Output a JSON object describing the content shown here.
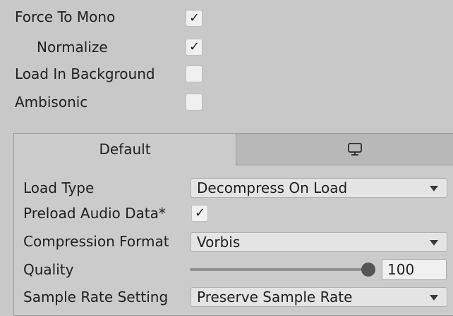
{
  "toggles": {
    "force_to_mono": {
      "label": "Force To Mono",
      "checked": true
    },
    "normalize": {
      "label": "Normalize",
      "checked": true
    },
    "load_in_background": {
      "label": "Load In Background",
      "checked": false
    },
    "ambisonic": {
      "label": "Ambisonic",
      "checked": false
    }
  },
  "platform_tabs": {
    "default_label": "Default",
    "standalone_icon": "monitor-icon"
  },
  "settings": {
    "load_type": {
      "label": "Load Type",
      "value": "Decompress On Load"
    },
    "preload_audio_data": {
      "label": "Preload Audio Data*",
      "checked": true
    },
    "compression_format": {
      "label": "Compression Format",
      "value": "Vorbis"
    },
    "quality": {
      "label": "Quality",
      "value": "100",
      "fraction": 1.0
    },
    "sample_rate_setting": {
      "label": "Sample Rate Setting",
      "value": "Preserve Sample Rate"
    }
  },
  "colors": {
    "background": "#c8c8c8",
    "field": "#e4e4e4",
    "inactive_tab": "#b8b8b8"
  }
}
